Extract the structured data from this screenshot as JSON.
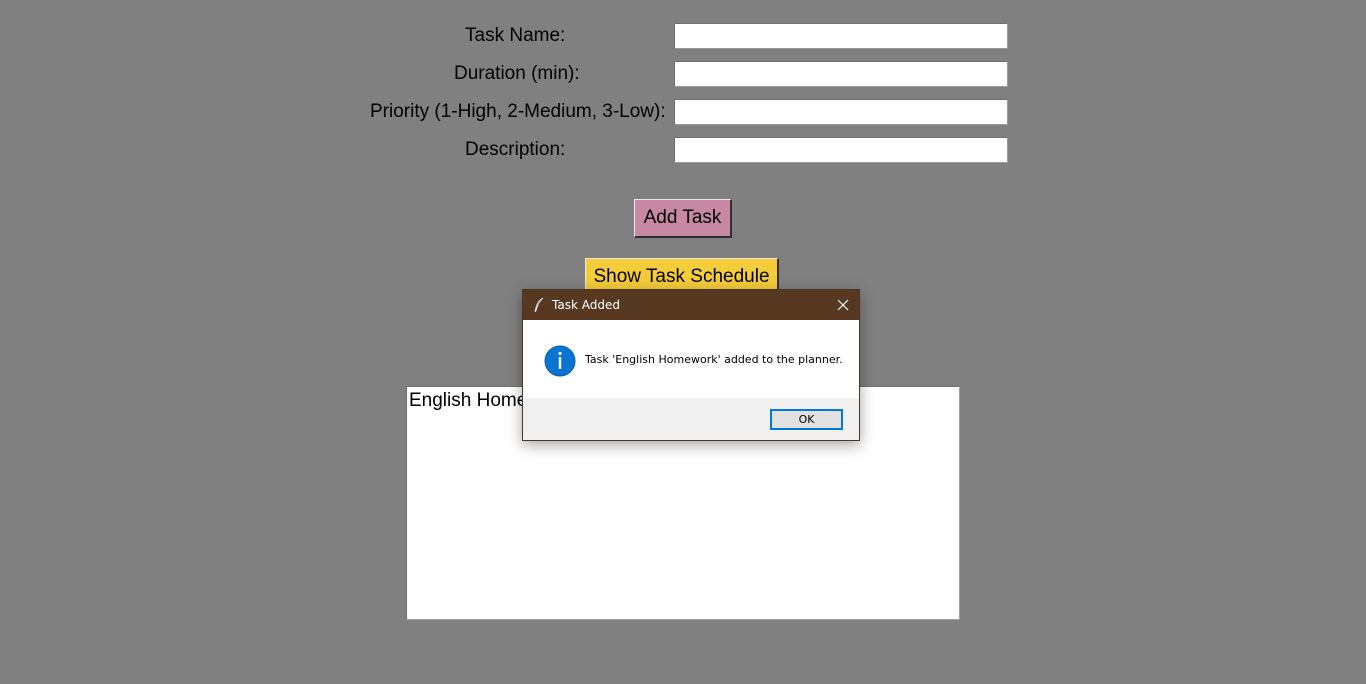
{
  "form": {
    "task_name_label": "Task Name:",
    "duration_label": "Duration (min):",
    "priority_label": "Priority (1-High, 2-Medium, 3-Low):",
    "description_label": "Description:",
    "task_name_value": "",
    "duration_value": "",
    "priority_value": "",
    "description_value": ""
  },
  "buttons": {
    "add_task": "Add Task",
    "show_schedule": "Show Task Schedule"
  },
  "output": {
    "line": "English Homework"
  },
  "dialog": {
    "title": "Task Added",
    "message": "Task 'English Homework' added to the planner.",
    "ok_label": "OK"
  },
  "colors": {
    "background": "#808080",
    "add_button": "#c688a3",
    "show_button": "#f5cc3a",
    "dialog_titlebar": "#573922",
    "info_blue": "#0078d7"
  }
}
